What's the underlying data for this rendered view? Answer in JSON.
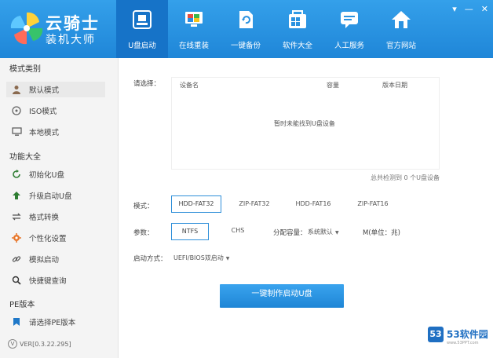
{
  "app": {
    "title": "云骑士",
    "subtitle": "装机大师"
  },
  "window": {
    "menu_icon": "menu-arrow-icon",
    "min": "—",
    "close": "✕"
  },
  "nav": [
    {
      "label": "U盘启动",
      "icon": "usb-boot-icon",
      "active": true
    },
    {
      "label": "在线重装",
      "icon": "monitor-icon",
      "active": false
    },
    {
      "label": "一键备份",
      "icon": "backup-icon",
      "active": false
    },
    {
      "label": "软件大全",
      "icon": "apps-icon",
      "active": false
    },
    {
      "label": "人工服务",
      "icon": "chat-icon",
      "active": false
    },
    {
      "label": "官方网站",
      "icon": "home-icon",
      "active": false
    }
  ],
  "sidebar": {
    "section1": "模式类别",
    "modes": [
      {
        "label": "默认模式",
        "icon": "user-icon"
      },
      {
        "label": "ISO模式",
        "icon": "disc-icon"
      },
      {
        "label": "本地模式",
        "icon": "monitor-small-icon"
      }
    ],
    "section2": "功能大全",
    "functions": [
      {
        "label": "初始化U盘",
        "icon": "refresh-icon"
      },
      {
        "label": "升级启动U盘",
        "icon": "up-arrow-icon"
      },
      {
        "label": "格式转换",
        "icon": "convert-icon"
      },
      {
        "label": "个性化设置",
        "icon": "gear-icon"
      },
      {
        "label": "模拟启动",
        "icon": "link-icon"
      },
      {
        "label": "快捷键查询",
        "icon": "search-icon"
      }
    ],
    "section3": "PE版本",
    "pe": {
      "label": "请选择PE版本",
      "icon": "bookmark-icon"
    },
    "version": "VER[0.3.22.295]"
  },
  "main": {
    "select_label": "请选择：",
    "columns": [
      "设备名",
      "容量",
      "版本日期"
    ],
    "empty": "暂时未能找到U盘设备",
    "count": "总共检测到 0 个U盘设备",
    "mode_label": "模式：",
    "modes": [
      "HDD-FAT32",
      "ZIP-FAT32",
      "HDD-FAT16",
      "ZIP-FAT16"
    ],
    "param_label": "参数：",
    "params": [
      "NTFS",
      "CHS"
    ],
    "alloc_label": "分配容量：",
    "alloc_value": "系统默认",
    "alloc_unit": "M(单位：兆)",
    "boot_label": "启动方式：",
    "boot_value": "UEFI/BIOS双启动",
    "make_button": "一键制作启动U盘"
  },
  "watermark": {
    "text": "53软件园",
    "badge": "53",
    "url": "www.53PPT.com"
  },
  "colors": {
    "header": "#2a92e0",
    "active_tab": "#1673c8",
    "button": "#2a92e0"
  }
}
